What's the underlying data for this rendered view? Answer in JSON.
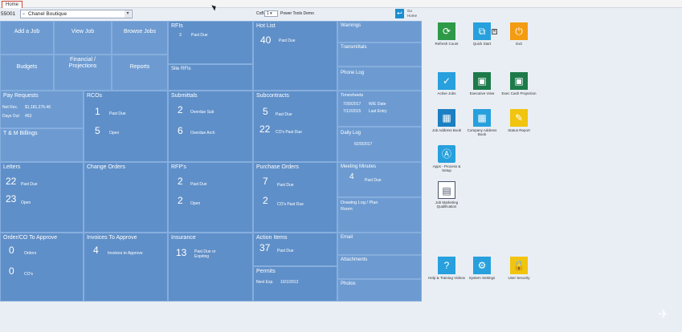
{
  "tab": {
    "label": "Home"
  },
  "header": {
    "job_number": "55001",
    "job_name": "Chanel Boutique",
    "company_label": "CoB",
    "company_value": "1",
    "company_name": "Power Tools Demo",
    "home_label": "Go Home"
  },
  "tiles": {
    "add_job": "Add a Job",
    "view_job": "View Job",
    "browse_jobs": "Browse Jobs",
    "budgets": "Budgets",
    "financial": "Financial / Projections",
    "reports": "Reports",
    "rfis": {
      "title": "RFIs",
      "count": "3",
      "label": "Past Due"
    },
    "hot_list": {
      "title": "Hot List",
      "count": "40",
      "label": "Past Due"
    },
    "warnings": "Warnings",
    "transmittals": "Transmittals",
    "site_rfis": "Site RFIs",
    "phone_log": "Phone Log",
    "pay_requests": {
      "title": "Pay Requests",
      "net_label": "Net Rec.",
      "net_value": "$1,181,276.46",
      "days_label": "Days Out",
      "days_value": "453"
    },
    "tm_billings": "T & M Billings",
    "rcos": {
      "title": "RCOs",
      "count1": "1",
      "label1": "Past Due",
      "count2": "5",
      "label2": "Open"
    },
    "submittals": {
      "title": "Submittals",
      "count1": "2",
      "label1": "Overdue Sub",
      "count2": "6",
      "label2": "Overdue Arch"
    },
    "subcontracts": {
      "title": "Subcontracts",
      "count1": "5",
      "label1": "Past Due",
      "count2": "22",
      "label2": "CO's Past Due"
    },
    "timesheets": {
      "title": "Timesheets",
      "date1": "7/30/2017",
      "label1": "W/E Date",
      "date2": "7/12/2015",
      "label2": "Last Entry"
    },
    "daily_log": {
      "title": "Daily Log",
      "date": "6/29/2017"
    },
    "letters": {
      "title": "Letters",
      "count1": "22",
      "label1": "Past Due",
      "count2": "23",
      "label2": "Open"
    },
    "change_orders": "Change Orders",
    "rfps": {
      "title": "RFP's",
      "count1": "2",
      "label1": "Past Due",
      "count2": "2",
      "label2": "Open"
    },
    "purchase_orders": {
      "title": "Purchase Orders",
      "count1": "7",
      "label1": "Past Due",
      "count2": "2",
      "label2": "CO's Past Due"
    },
    "meeting_minutes": {
      "title": "Meeting Minutes",
      "count": "4",
      "label": "Past Due"
    },
    "drawing_log": "Drawing Log / Plan Room",
    "order_co": {
      "title": "Order/CO To Approve",
      "count1": "0",
      "label1": "Orders",
      "count2": "0",
      "label2": "CO's"
    },
    "invoices": {
      "title": "Invoices To Approve",
      "count": "4",
      "label": "Invoices to Approve"
    },
    "insurance": {
      "title": "Insurance",
      "count": "13",
      "label": "Past Due or Expiring"
    },
    "action_items": {
      "title": "Action Items",
      "count": "37",
      "label": "Past Due"
    },
    "permits": {
      "title": "Permits",
      "label": "Next Exp.",
      "value": "10/1/2013"
    },
    "email": "Email",
    "attachments": "Attachments",
    "photos": "Photos"
  },
  "launchers": [
    {
      "label": "Refresh Count",
      "icon": "refresh-icon",
      "color": "#2e9a48"
    },
    {
      "label": "Quick Start",
      "icon": "quick-start-icon",
      "color": "#27a0dd"
    },
    {
      "label": "Exit",
      "icon": "power-icon",
      "color": "#f39c12"
    },
    {
      "label": "Active Jobs",
      "icon": "checkmark-icon",
      "color": "#27a0dd"
    },
    {
      "label": "Executive View",
      "icon": "executive-icon",
      "color": "#1e7a4a"
    },
    {
      "label": "Exec Cash Projection",
      "icon": "cash-projection-icon",
      "color": "#1e7a4a"
    },
    {
      "label": "Job Address Book",
      "icon": "address-book-icon",
      "color": "#1b7fc2"
    },
    {
      "label": "Company Address Book",
      "icon": "company-address-icon",
      "color": "#27a0dd"
    },
    {
      "label": "Status Report",
      "icon": "status-report-icon",
      "color": "#f1c40f"
    },
    {
      "label": "Apps - Process & Setup",
      "icon": "apps-icon",
      "color": "#27a0dd"
    },
    {
      "label": "Job Marketing Qualification",
      "icon": "marketing-icon",
      "color": "#4a5568"
    },
    {
      "label": "Help & Training Videos",
      "icon": "help-icon",
      "color": "#27a0dd"
    },
    {
      "label": "System Settings",
      "icon": "settings-icon",
      "color": "#27a0dd"
    },
    {
      "label": "User Security",
      "icon": "lock-icon",
      "color": "#f1c40f"
    }
  ]
}
